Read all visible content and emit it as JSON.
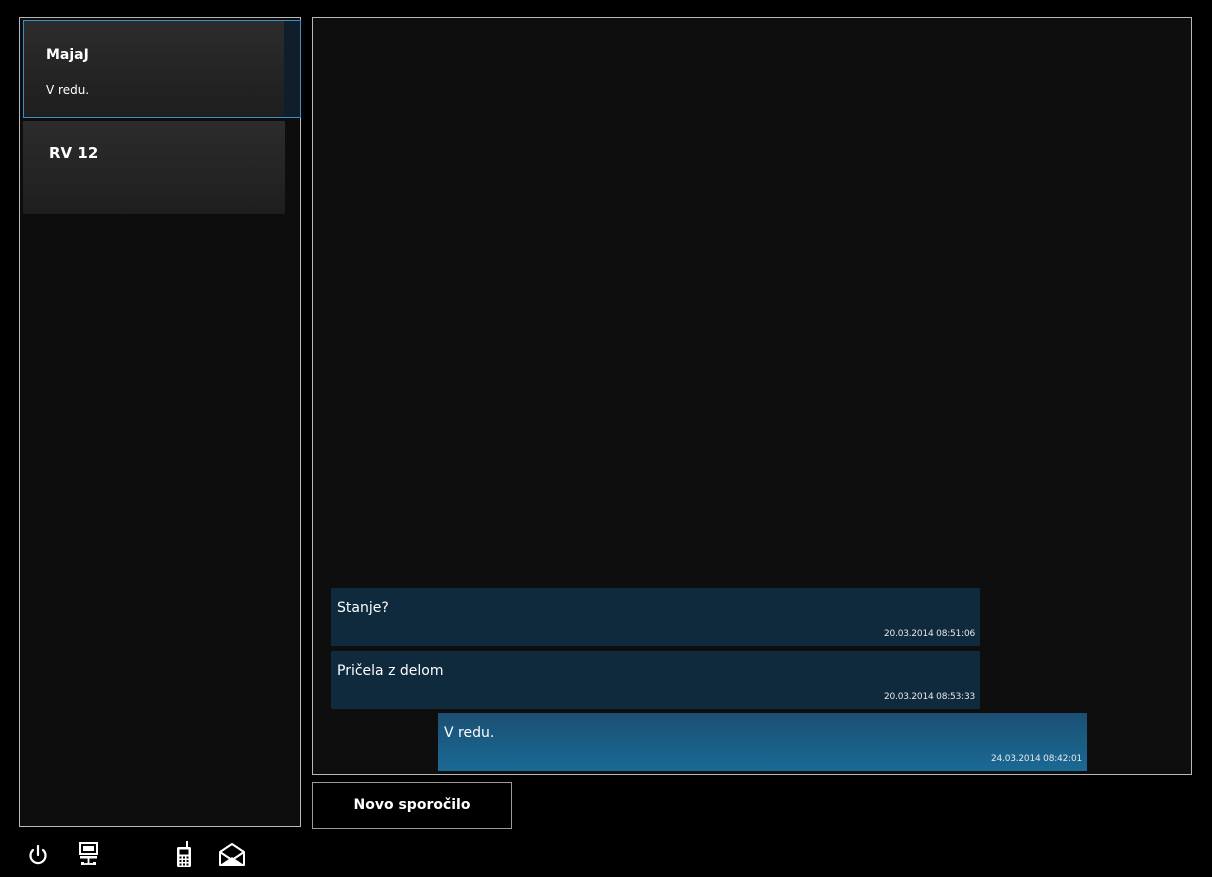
{
  "conversations": [
    {
      "name": "MajaJ",
      "preview": "V redu.",
      "selected": true
    },
    {
      "name": "RV 12",
      "preview": "",
      "selected": false
    }
  ],
  "messages": [
    {
      "text": "Stanje?",
      "time": "20.03.2014 08:51:06",
      "direction": "incoming"
    },
    {
      "text": "Pričela z delom",
      "time": "20.03.2014 08:53:33",
      "direction": "incoming"
    },
    {
      "text": "V redu.",
      "time": "24.03.2014 08:42:01",
      "direction": "outgoing"
    }
  ],
  "actions": {
    "new_message_label": "Novo sporočilo"
  },
  "bottom_icons": [
    "power-icon",
    "network-icon",
    "radio-device-icon",
    "mail-icon"
  ],
  "colors": {
    "incoming_bubble": "#0f2a3c",
    "outgoing_bubble": "#1a6a95",
    "selection_border": "#3a8fc4",
    "panel_border": "#b8b8b8"
  }
}
